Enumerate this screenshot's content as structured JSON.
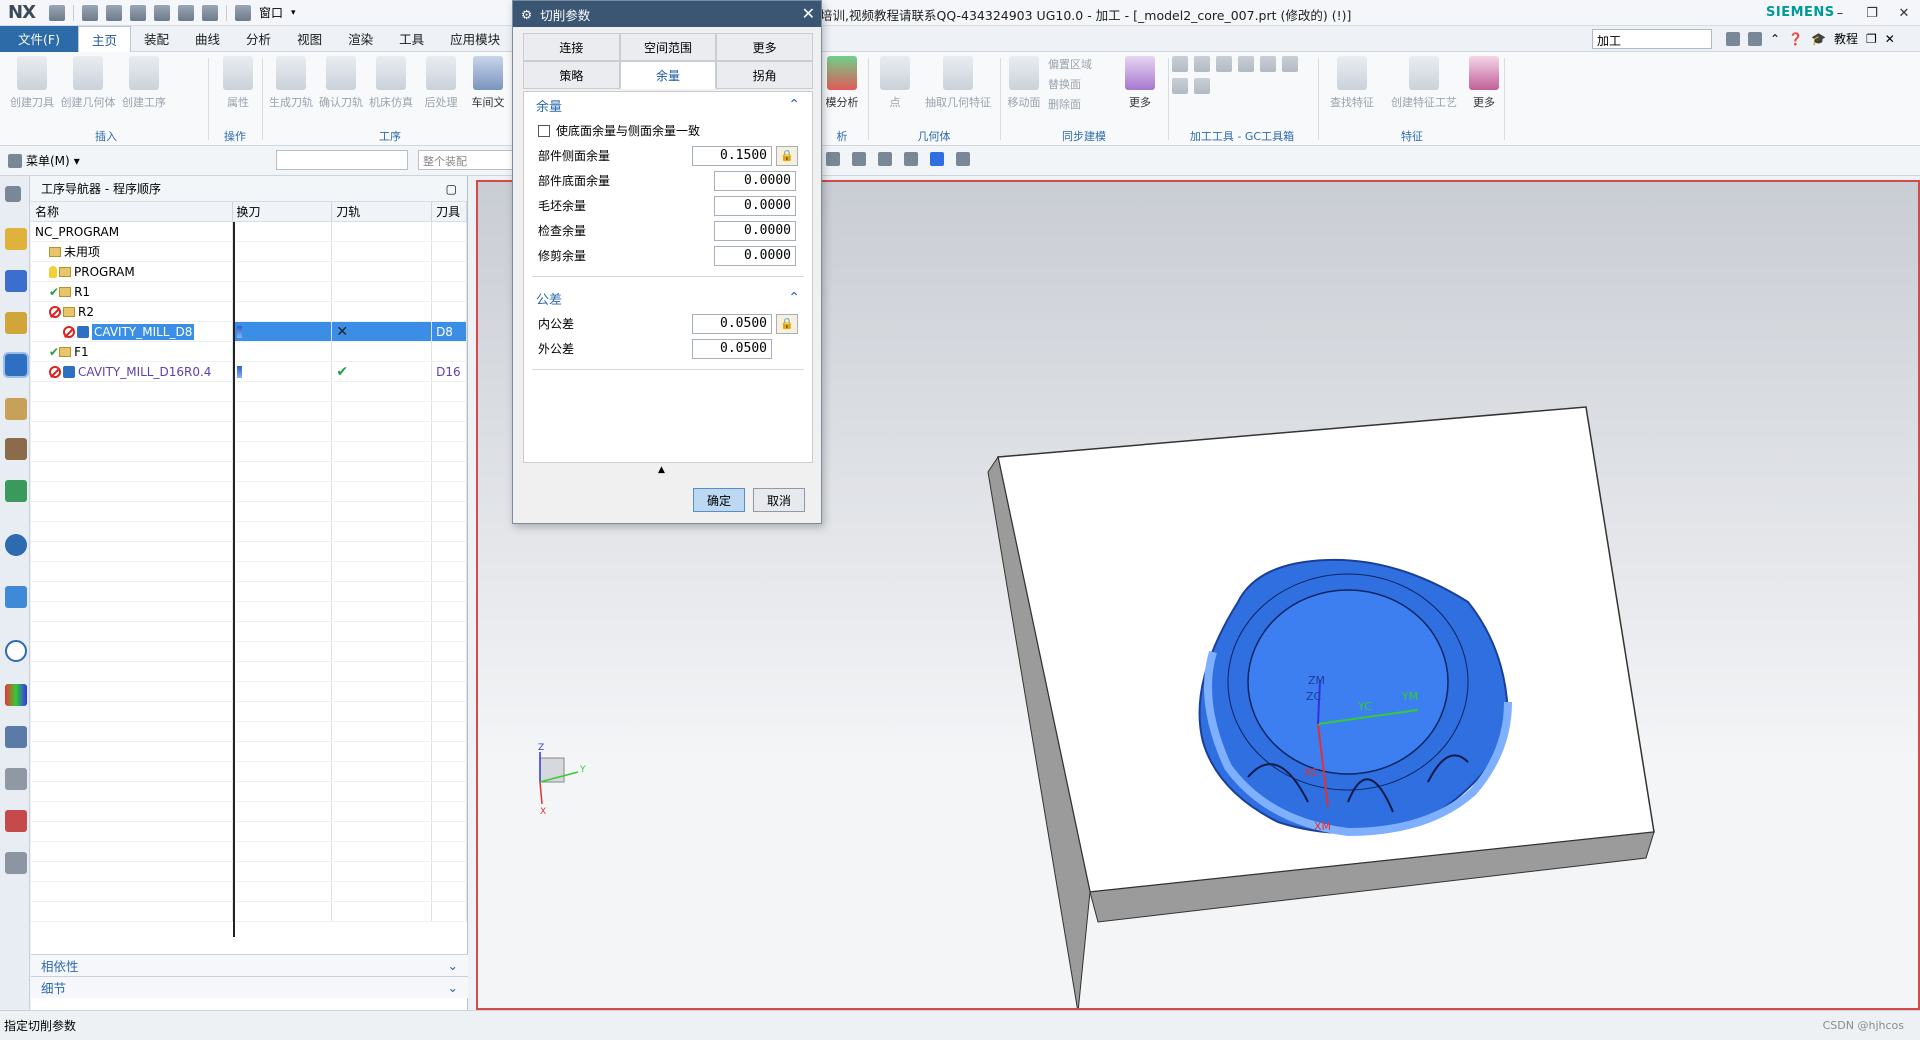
{
  "app": {
    "logo": "NX",
    "title": "培训,视频教程请联系QQ-434324903 UG10.0 - 加工 - [_model2_core_007.prt  (修改的)     (!)]",
    "brand": "SIEMENS",
    "window_menu": "窗口"
  },
  "menubar": {
    "file": "文件(F)",
    "tabs": [
      "主页",
      "装配",
      "曲线",
      "分析",
      "视图",
      "渲染",
      "工具",
      "应用模块"
    ],
    "active_tab": "主页",
    "search_value": "加工",
    "tutorial": "教程"
  },
  "ribbon": {
    "insert_buttons": [
      "创建刀具",
      "创建几何体",
      "创建工序"
    ],
    "insert_group": "插入",
    "ops_button": "属性",
    "ops_group": "操作",
    "proc_buttons": [
      "生成刀轨",
      "确认刀轨",
      "机床仿真",
      "后处理",
      "车间文"
    ],
    "proc_group": "工序",
    "analysis_button": "模分析",
    "analysis_group": "析",
    "geometry_buttons": [
      "点",
      "抽取几何特征"
    ],
    "geometry_group": "几何体",
    "sync_buttons": [
      "移动面"
    ],
    "sync_small": [
      "偏置区域",
      "替换面",
      "删除面"
    ],
    "sync_more": "更多",
    "sync_group": "同步建模",
    "gc_group": "加工工具 - GC工具箱",
    "feature_buttons": [
      "查找特征",
      "创建特征工艺"
    ],
    "feature_more": "更多",
    "feature_group": "特征"
  },
  "toolbar2": {
    "menu": "菜单(M)",
    "filter_placeholder": "",
    "scope": "整个装配"
  },
  "navigator": {
    "title": "工序导航器 - 程序顺序",
    "columns": [
      "名称",
      "换刀",
      "刀轨",
      "刀具"
    ],
    "rows": [
      {
        "name": "NC_PROGRAM",
        "indent": 0,
        "icon": "none",
        "status": "",
        "change": "",
        "path": "",
        "tool": ""
      },
      {
        "name": "未用项",
        "indent": 1,
        "icon": "folder",
        "status": "",
        "change": "",
        "path": "",
        "tool": ""
      },
      {
        "name": "PROGRAM",
        "indent": 1,
        "icon": "bulb-folder",
        "status": "",
        "change": "",
        "path": "",
        "tool": ""
      },
      {
        "name": "R1",
        "indent": 1,
        "icon": "ok-folder",
        "status": "ok",
        "change": "",
        "path": "",
        "tool": ""
      },
      {
        "name": "R2",
        "indent": 1,
        "icon": "no-folder",
        "status": "no",
        "change": "",
        "path": "",
        "tool": ""
      },
      {
        "name": "CAVITY_MILL_D8",
        "indent": 2,
        "icon": "no-tool",
        "status": "no",
        "change": "bar",
        "path": "✕",
        "tool": "D8",
        "selected": true
      },
      {
        "name": "F1",
        "indent": 1,
        "icon": "ok-folder",
        "status": "ok",
        "change": "",
        "path": "",
        "tool": ""
      },
      {
        "name": "CAVITY_MILL_D16R0.4",
        "indent": 1,
        "icon": "no-tool",
        "status": "no",
        "change": "bar",
        "path": "✔",
        "tool": "D16"
      }
    ],
    "acc_dependencies": "相依性",
    "acc_details": "细节"
  },
  "dialog": {
    "title": "切削参数",
    "tabs_row1": [
      "连接",
      "空间范围",
      "更多"
    ],
    "tabs_row2": [
      "策略",
      "余量",
      "拐角"
    ],
    "active_tab": "余量",
    "section_stock": "余量",
    "checkbox_label": "使底面余量与侧面余量一致",
    "fields": [
      {
        "label": "部件侧面余量",
        "value": "0.1500"
      },
      {
        "label": "部件底面余量",
        "value": "0.0000"
      },
      {
        "label": "毛坯余量",
        "value": "0.0000"
      },
      {
        "label": "检查余量",
        "value": "0.0000"
      },
      {
        "label": "修剪余量",
        "value": "0.0000"
      }
    ],
    "section_tolerance": "公差",
    "tolerances": [
      {
        "label": "内公差",
        "value": "0.0500"
      },
      {
        "label": "外公差",
        "value": "0.0500"
      }
    ],
    "ok": "确定",
    "cancel": "取消"
  },
  "graphics": {
    "axis_labels": [
      "ZM",
      "ZC",
      "YC",
      "YM",
      "XM",
      "XC"
    ],
    "triad": [
      "Z",
      "Y",
      "X"
    ]
  },
  "status": {
    "text": "指定切削参数",
    "watermark": "CSDN @hjhcos"
  },
  "colors": {
    "accent": "#2c6aa8",
    "selection": "#3a8ee6",
    "part_blue": "#2f6fe0",
    "view_border": "#d54a4a"
  }
}
